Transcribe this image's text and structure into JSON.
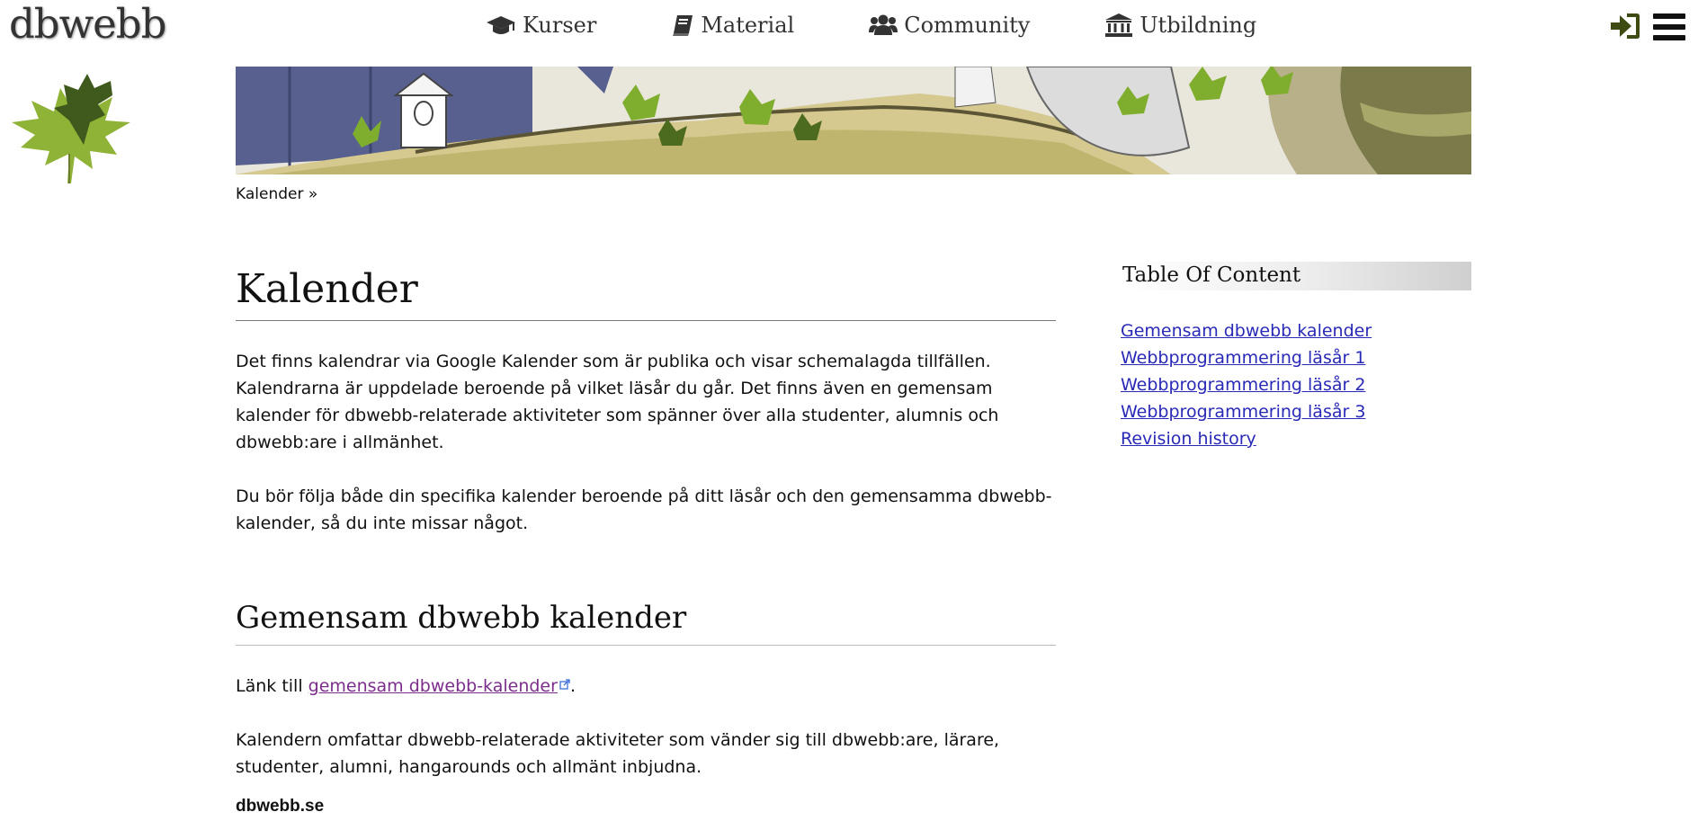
{
  "header": {
    "logo": "dbwebb",
    "nav": [
      {
        "label": "Kurser",
        "icon": "graduation-cap-icon"
      },
      {
        "label": "Material",
        "icon": "book-icon"
      },
      {
        "label": "Community",
        "icon": "users-icon"
      },
      {
        "label": "Utbildning",
        "icon": "institution-icon"
      }
    ],
    "right_icons": [
      "sign-in-icon",
      "hamburger-menu-icon"
    ]
  },
  "breadcrumb": {
    "label": "Kalender",
    "separator": " »"
  },
  "article": {
    "title": "Kalender",
    "intro_1": "Det finns kalendrar via Google Kalender som är publika och visar schemalagda tillfällen. Kalendrarna är uppdelade beroende på vilket läsår du går. Det finns även en gemensam kalender för dbwebb-relaterade aktiviteter som spänner över alla studenter, alumnis och dbwebb:are i allmänhet.",
    "intro_2": "Du bör följa både din specifika kalender beroende på ditt läsår och den gemensamma dbwebb-kalender, så du inte missar något.",
    "section_title": "Gemensam dbwebb kalender",
    "link_prefix": "Länk till ",
    "link_text": "gemensam dbwebb-kalender",
    "link_suffix": ".",
    "section_text": "Kalendern omfattar dbwebb-relaterade aktiviteter som vänder sig till dbwebb:are, lärare, studenter, alumni, hangarounds och allmänt inbjudna.",
    "site_label": "dbwebb.se"
  },
  "toc": {
    "title": "Table Of Content",
    "items": [
      "Gemensam dbwebb kalender",
      "Webbprogrammering läsår 1",
      "Webbprogrammering läsår 2",
      "Webbprogrammering läsår 3",
      "Revision history"
    ]
  },
  "colors": {
    "link": "#2929b8",
    "visited_link": "#7b2d8b",
    "text": "#111111",
    "login_icon": "#3d4a12"
  }
}
